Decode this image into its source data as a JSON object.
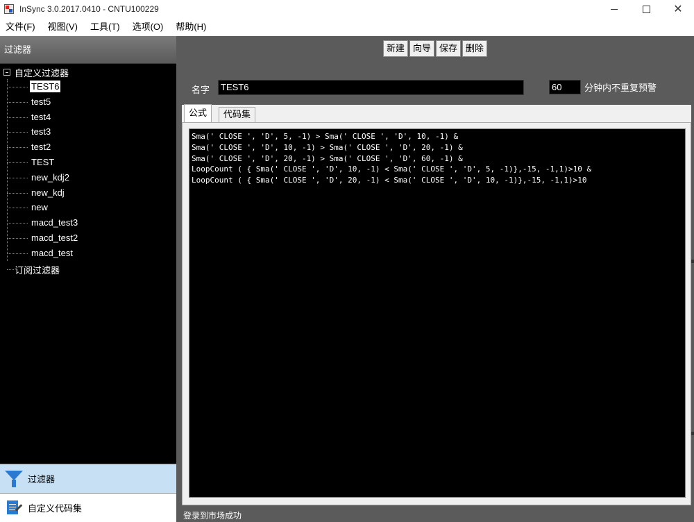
{
  "window": {
    "title": "InSync 3.0.2017.0410 - CNTU100229",
    "minimize": "",
    "maximize": "",
    "close": "✕"
  },
  "menu": {
    "items": [
      "文件(F)",
      "视图(V)",
      "工具(T)",
      "选项(O)",
      "帮助(H)"
    ]
  },
  "sidebar": {
    "header": "过滤器",
    "tree": {
      "root_label": "自定义过滤器",
      "children": [
        "TEST6",
        "test5",
        "test4",
        "test3",
        "test2",
        "TEST",
        "new_kdj2",
        "new_kdj",
        "new",
        "macd_test3",
        "macd_test2",
        "macd_test"
      ],
      "selected": "TEST6",
      "second_root_label": "订阅过滤器"
    },
    "nav": {
      "filters_label": "过滤器",
      "codesets_label": "自定义代码集"
    }
  },
  "toolbar": {
    "new_label": "新建",
    "wizard_label": "向导",
    "save_label": "保存",
    "delete_label": "删除"
  },
  "form": {
    "name_label": "名字",
    "name_value": "TEST6",
    "minutes_value": "60",
    "minutes_label": "分钟内不重复预警"
  },
  "tabs": {
    "formula": "公式",
    "codeset": "代码集"
  },
  "editor": {
    "lines": [
      "Sma(' CLOSE ', 'D', 5, -1) > Sma(' CLOSE ', 'D', 10, -1) &",
      "Sma(' CLOSE ', 'D', 10, -1) > Sma(' CLOSE ', 'D', 20, -1) &",
      "Sma(' CLOSE ', 'D', 20, -1) > Sma(' CLOSE ', 'D', 60, -1) &",
      "LoopCount ( { Sma(' CLOSE ', 'D', 10, -1) < Sma(' CLOSE ', 'D', 5, -1)},-15, -1,1)>10 &",
      "LoopCount ( { Sma(' CLOSE ', 'D', 20, -1) < Sma(' CLOSE ', 'D', 10, -1)},-15, -1,1)>10"
    ]
  },
  "status": {
    "text": "登录到市场成功"
  }
}
